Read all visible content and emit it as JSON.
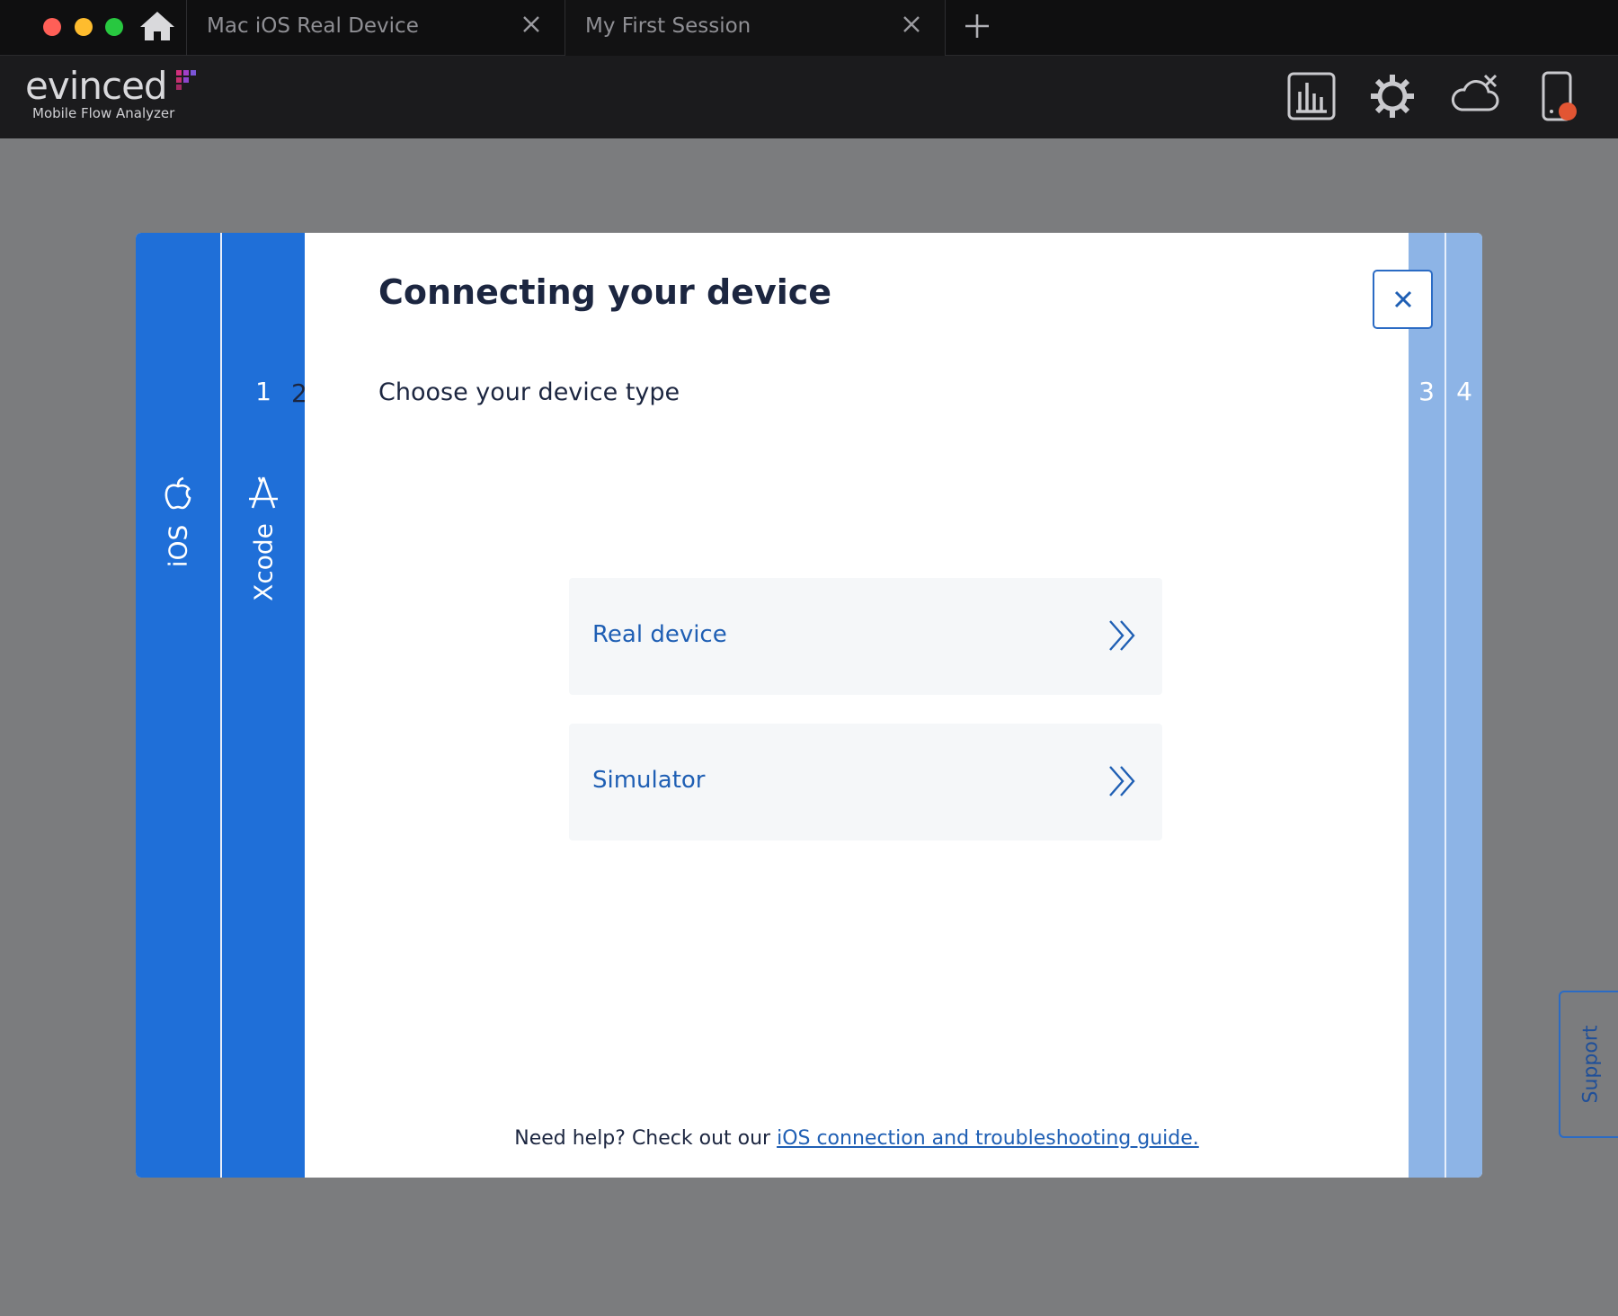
{
  "tabs": [
    {
      "label": "Mac iOS Real Device"
    },
    {
      "label": "My First Session"
    }
  ],
  "header": {
    "logo_text": "evinced",
    "logo_subtitle": "Mobile Flow Analyzer"
  },
  "modal": {
    "title": "Connecting your device",
    "steps": [
      {
        "number": "1",
        "label": "iOS",
        "icon": "apple-icon"
      },
      {
        "number": "1",
        "label": "Xcode",
        "icon": "xcode-app-store-icon"
      },
      {
        "number": "2",
        "label": "Choose your device type"
      },
      {
        "number": "3"
      },
      {
        "number": "4"
      }
    ],
    "options": [
      {
        "label": "Real device"
      },
      {
        "label": "Simulator"
      }
    ],
    "help_text": "Need help? Check out our ",
    "help_link": "iOS connection and troubleshooting guide."
  },
  "support_label": "Support",
  "colors": {
    "primary_blue": "#1f6fd8",
    "light_blue": "#8db4e6",
    "link_blue": "#1f5fb4"
  }
}
